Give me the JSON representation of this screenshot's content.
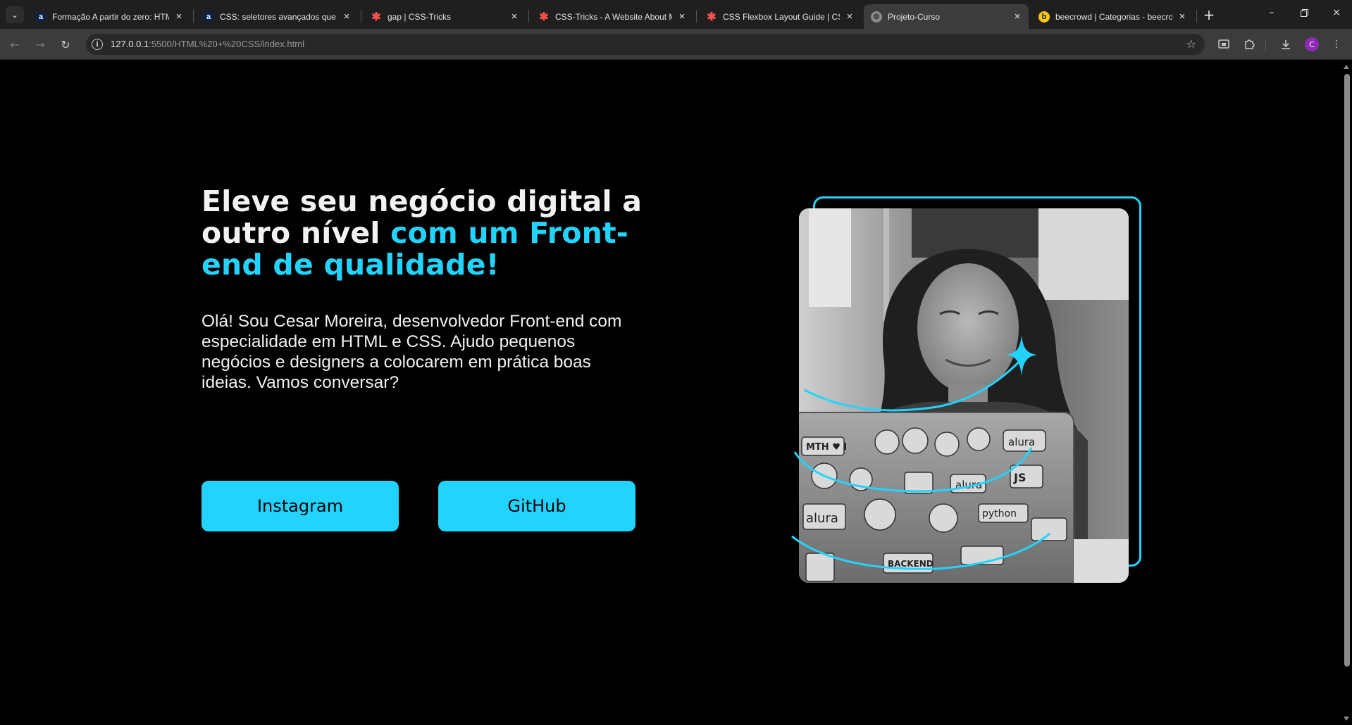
{
  "browser": {
    "tabs": [
      {
        "title": "Formação A partir do zero: HTM",
        "favicon": "a",
        "active": false
      },
      {
        "title": "CSS: seletores avançados que fa",
        "favicon": "a",
        "active": false
      },
      {
        "title": "gap | CSS-Tricks",
        "favicon": "*",
        "active": false
      },
      {
        "title": "CSS-Tricks - A Website About M",
        "favicon": "*",
        "active": false
      },
      {
        "title": "CSS Flexbox Layout Guide | CSS",
        "favicon": "*",
        "active": false
      },
      {
        "title": "Projeto-Curso",
        "favicon": "globe",
        "active": true
      },
      {
        "title": "beecrowd | Categorias - beecro",
        "favicon": "b",
        "active": false
      }
    ],
    "url_host": "127.0.0.1",
    "url_rest": ":5500/HTML%20+%20CSS/index.html",
    "profile_initial": "C",
    "icons": {
      "tab_search": "chevron-down-icon",
      "close": "close-icon",
      "new_tab": "plus-icon",
      "minimize": "minimize-icon",
      "restore": "restore-icon",
      "window_close": "close-icon",
      "back": "back-arrow-icon",
      "forward": "forward-arrow-icon",
      "reload": "reload-icon",
      "site_info": "info-icon",
      "bookmark": "star-icon",
      "cast": "cast-icon",
      "extensions": "puzzle-icon",
      "downloads": "download-icon",
      "menu": "kebab-menu-icon"
    }
  },
  "hero": {
    "headline_white": "Eleve seu negócio digital a outro nível",
    "headline_accent": "com um Front-end de qualidade!",
    "intro": "Olá! Sou Cesar Moreira, desenvolvedor Front-end com especialidade em HTML e CSS. Ajudo pequenos negócios e designers a colocarem em prática boas ideias. Vamos conversar?",
    "buttons": {
      "instagram": "Instagram",
      "github": "GitHub"
    },
    "accent_color": "#22d4fd",
    "photo_subject": "woman smiling at laptop covered in stickers"
  }
}
